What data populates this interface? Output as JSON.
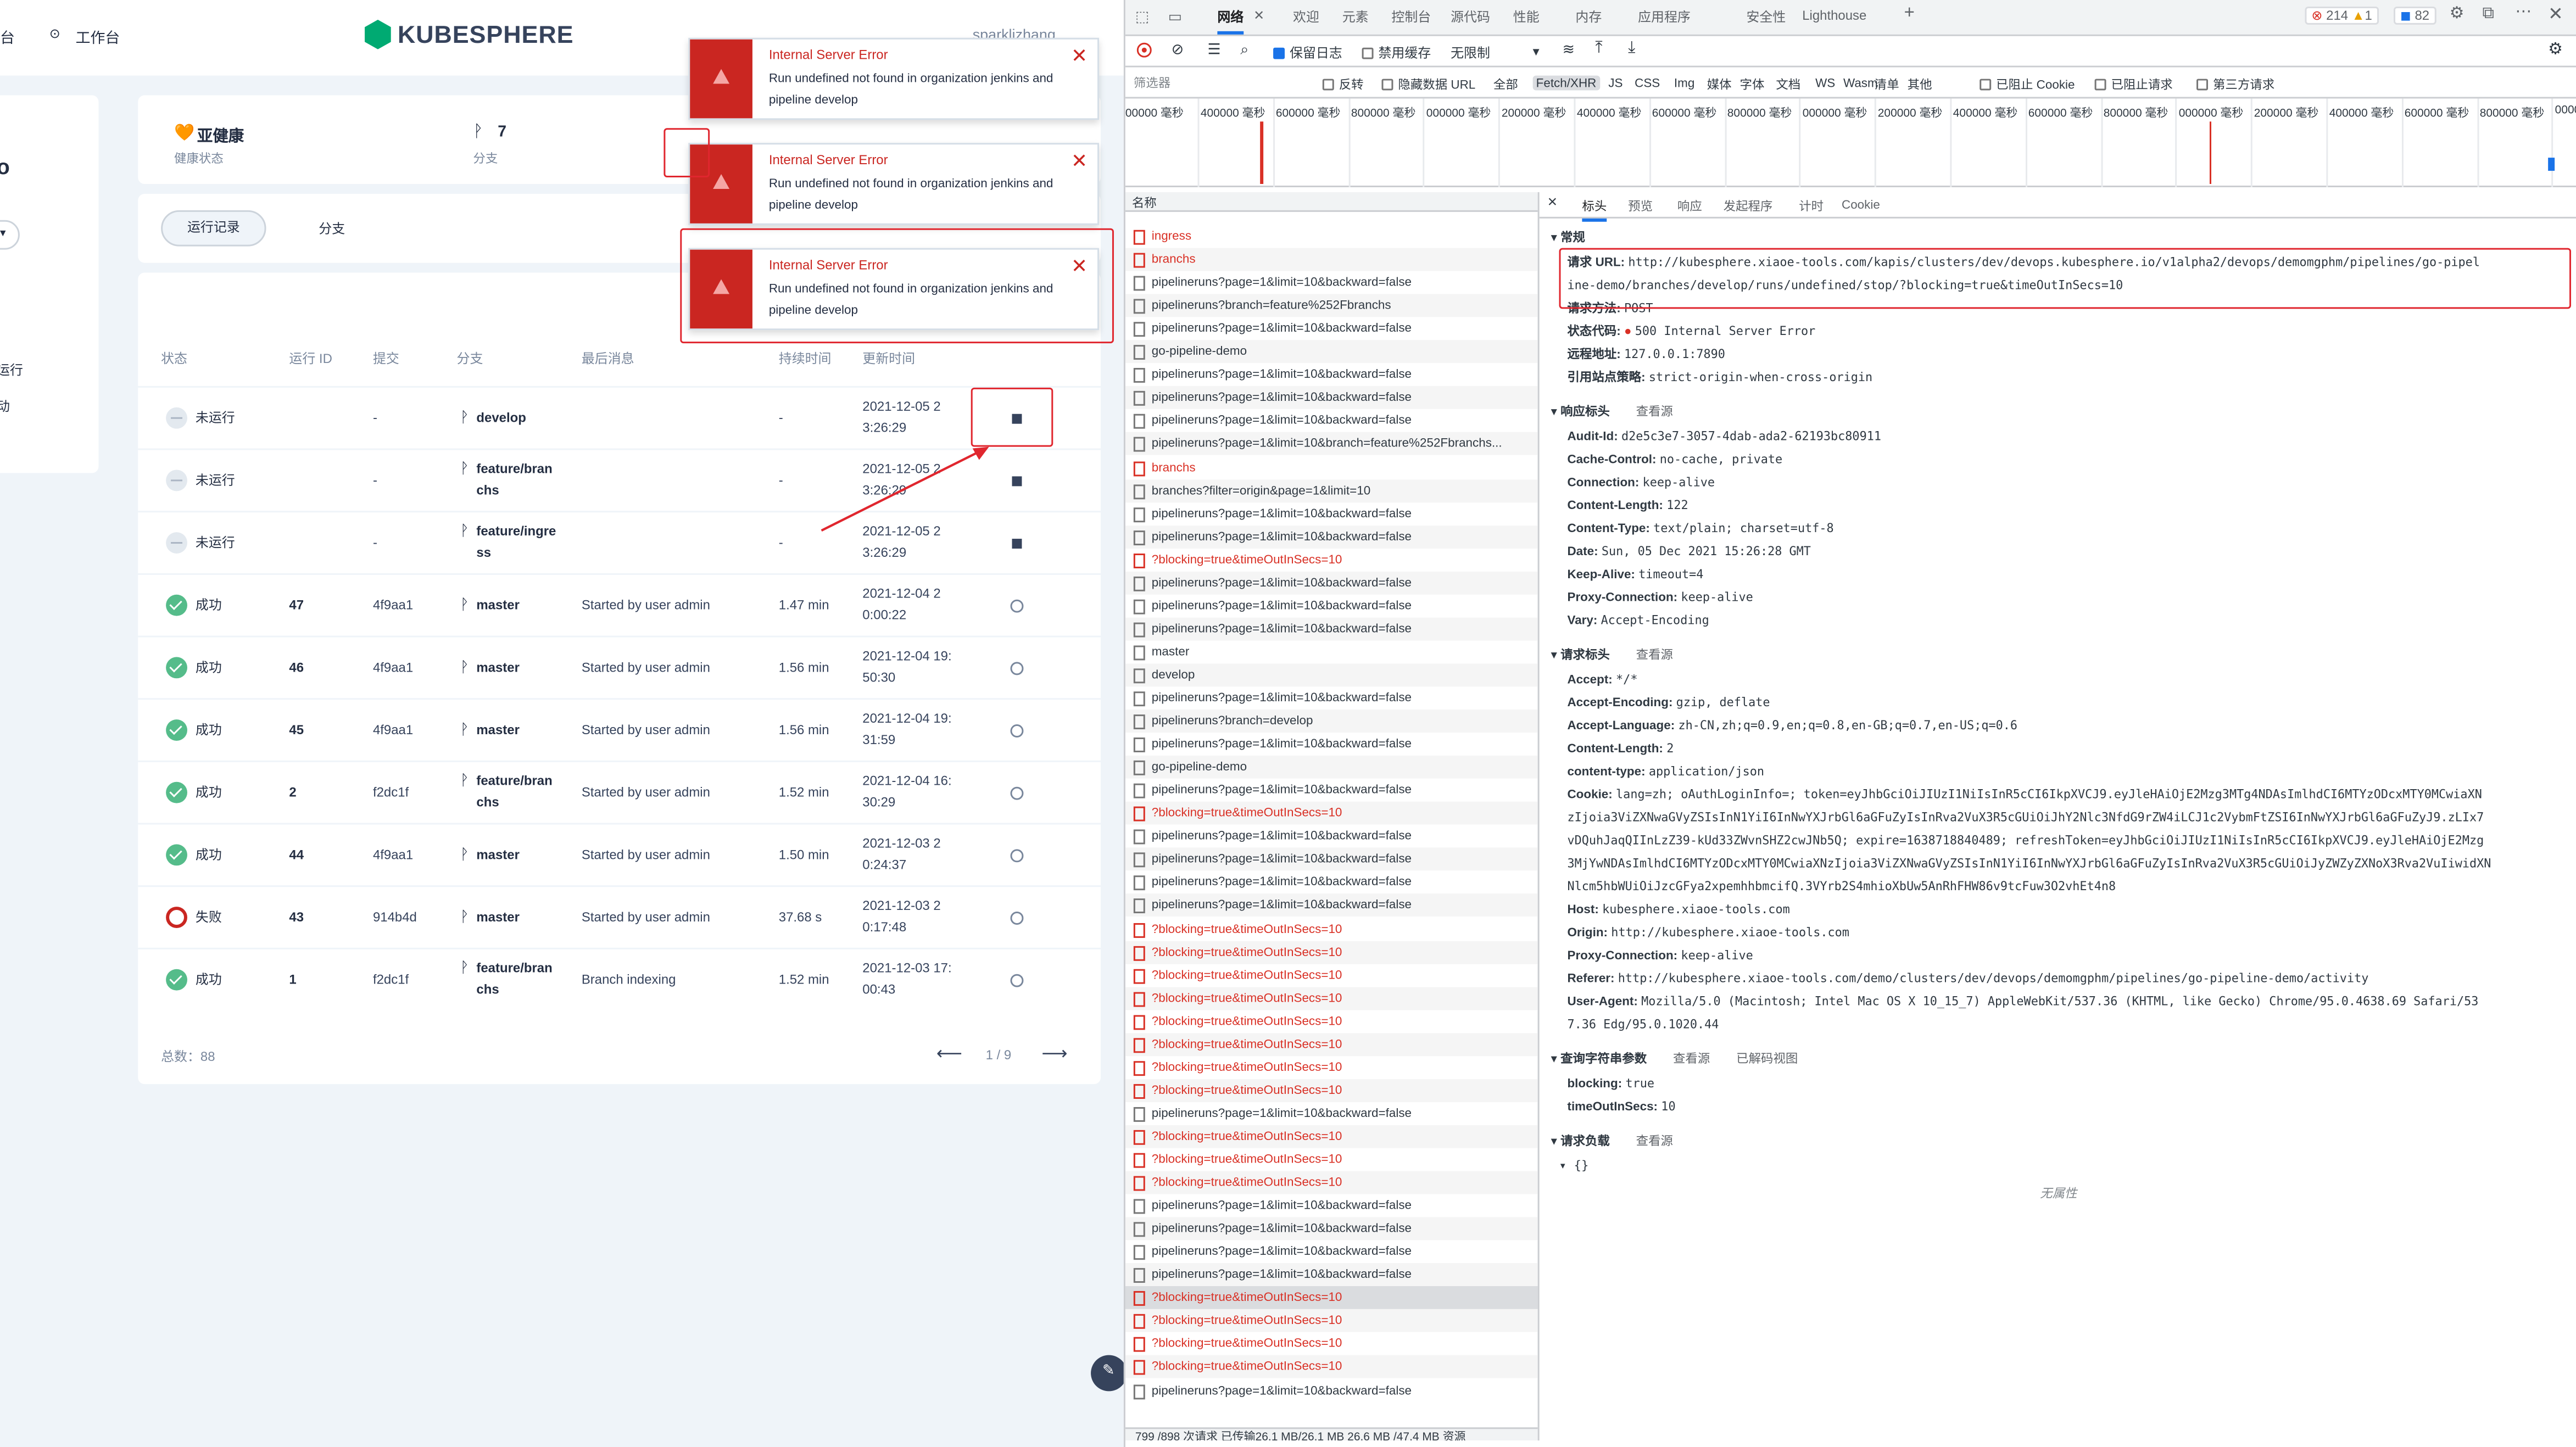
{
  "app": {
    "nav": {
      "left_partial": "台",
      "workbench": "工作台",
      "logo": "KUBESPHERE",
      "user": "sparklizhang"
    },
    "side": {
      "title_partial": "o",
      "item1": "运行",
      "item2": "动"
    },
    "info": {
      "health_value": "亚健康",
      "health_label": "健康状态",
      "branch_count": "7",
      "branch_label": "分支"
    },
    "tabs": {
      "active": "运行记录",
      "other": "分支"
    },
    "table": {
      "headers": [
        "状态",
        "运行 ID",
        "提交",
        "分支",
        "最后消息",
        "持续时间",
        "更新时间"
      ],
      "rows": [
        {
          "status": "未运行",
          "kind": "none",
          "id": "",
          "commit": "-",
          "branch": "develop",
          "msg": "",
          "duration": "-",
          "time": "2021-12-05 2\n3:26:29",
          "action": "stop"
        },
        {
          "status": "未运行",
          "kind": "none",
          "id": "",
          "commit": "-",
          "branch": "feature/bran\nchs",
          "msg": "",
          "duration": "-",
          "time": "2021-12-05 2\n3:26:29",
          "action": "stop"
        },
        {
          "status": "未运行",
          "kind": "none",
          "id": "",
          "commit": "-",
          "branch": "feature/ingre\nss",
          "msg": "",
          "duration": "-",
          "time": "2021-12-05 2\n3:26:29",
          "action": "stop"
        },
        {
          "status": "成功",
          "kind": "ok",
          "id": "47",
          "commit": "4f9aa1",
          "branch": "master",
          "msg": "Started by user admin",
          "duration": "1.47 min",
          "time": "2021-12-04 2\n0:00:22",
          "action": "rerun"
        },
        {
          "status": "成功",
          "kind": "ok",
          "id": "46",
          "commit": "4f9aa1",
          "branch": "master",
          "msg": "Started by user admin",
          "duration": "1.56 min",
          "time": "2021-12-04 19:\n50:30",
          "action": "rerun"
        },
        {
          "status": "成功",
          "kind": "ok",
          "id": "45",
          "commit": "4f9aa1",
          "branch": "master",
          "msg": "Started by user admin",
          "duration": "1.56 min",
          "time": "2021-12-04 19:\n31:59",
          "action": "rerun"
        },
        {
          "status": "成功",
          "kind": "ok",
          "id": "2",
          "commit": "f2dc1f",
          "branch": "feature/bran\nchs",
          "msg": "Started by user admin",
          "duration": "1.52 min",
          "time": "2021-12-04 16:\n30:29",
          "action": "rerun"
        },
        {
          "status": "成功",
          "kind": "ok",
          "id": "44",
          "commit": "4f9aa1",
          "branch": "master",
          "msg": "Started by user admin",
          "duration": "1.50 min",
          "time": "2021-12-03 2\n0:24:37",
          "action": "rerun"
        },
        {
          "status": "失败",
          "kind": "fail",
          "id": "43",
          "commit": "914b4d",
          "branch": "master",
          "msg": "Started by user admin",
          "duration": "37.68 s",
          "time": "2021-12-03 2\n0:17:48",
          "action": "rerun"
        },
        {
          "status": "成功",
          "kind": "ok",
          "id": "1",
          "commit": "f2dc1f",
          "branch": "feature/bran\nchs",
          "msg": "Branch indexing",
          "duration": "1.52 min",
          "time": "2021-12-03 17:\n00:43",
          "action": "rerun"
        }
      ],
      "total": "总数：88",
      "page": "1 / 9"
    },
    "toasts": [
      {
        "title": "Internal Server Error",
        "msg": "Run undefined not found in organization jenkins and pipeline develop"
      },
      {
        "title": "Internal Server Error",
        "msg": "Run undefined not found in organization jenkins and pipeline develop"
      },
      {
        "title": "Internal Server Error",
        "msg": "Run undefined not found in organization jenkins and pipeline develop"
      }
    ]
  },
  "devtools": {
    "tabs": [
      "网络",
      "欢迎",
      "元素",
      "控制台",
      "源代码",
      "性能",
      "内存",
      "应用程序",
      "安全性",
      "Lighthouse"
    ],
    "counts": {
      "errors": "214",
      "warnings": "1",
      "info": "82"
    },
    "toolbar": {
      "preserve_log": "保留日志",
      "disable_cache": "禁用缓存",
      "throttle": "无限制"
    },
    "filter": {
      "placeholder": "筛选器",
      "invert": "反转",
      "hide_data": "隐藏数据 URL",
      "all": "全部",
      "types": [
        "Fetch/XHR",
        "JS",
        "CSS",
        "Img",
        "媒体",
        "字体",
        "文档",
        "WS",
        "Wasm",
        "清单",
        "其他"
      ],
      "blocked_cookies": "已阻止 Cookie",
      "blocked_requests": "已阻止请求",
      "third_party": "第三方请求"
    },
    "timeline_ticks": [
      "00000 毫秒",
      "400000 毫秒",
      "600000 毫秒",
      "800000 毫秒",
      "000000 毫秒",
      "200000 毫秒",
      "400000 毫秒",
      "600000 毫秒",
      "800000 毫秒",
      "000000 毫秒",
      "200000 毫秒",
      "400000 毫秒",
      "600000 毫秒",
      "800000 毫秒",
      "000000 毫秒",
      "200000 毫秒",
      "400000 毫秒",
      "600000 毫秒",
      "800000 毫秒",
      "000000"
    ],
    "name_header": "名称",
    "requests": [
      {
        "n": "ingress",
        "e": true
      },
      {
        "n": "branchs",
        "e": true
      },
      {
        "n": "pipelineruns?page=1&limit=10&backward=false",
        "e": false
      },
      {
        "n": "pipelineruns?branch=feature%252Fbranchs",
        "e": false
      },
      {
        "n": "pipelineruns?page=1&limit=10&backward=false",
        "e": false
      },
      {
        "n": "go-pipeline-demo",
        "e": false
      },
      {
        "n": "pipelineruns?page=1&limit=10&backward=false",
        "e": false
      },
      {
        "n": "pipelineruns?page=1&limit=10&backward=false",
        "e": false
      },
      {
        "n": "pipelineruns?page=1&limit=10&backward=false",
        "e": false
      },
      {
        "n": "pipelineruns?page=1&limit=10&branch=feature%252Fbranchs...",
        "e": false
      },
      {
        "n": "branchs",
        "e": true
      },
      {
        "n": "branches?filter=origin&page=1&limit=10",
        "e": false
      },
      {
        "n": "pipelineruns?page=1&limit=10&backward=false",
        "e": false
      },
      {
        "n": "pipelineruns?page=1&limit=10&backward=false",
        "e": false
      },
      {
        "n": "?blocking=true&timeOutInSecs=10",
        "e": true
      },
      {
        "n": "pipelineruns?page=1&limit=10&backward=false",
        "e": false
      },
      {
        "n": "pipelineruns?page=1&limit=10&backward=false",
        "e": false
      },
      {
        "n": "pipelineruns?page=1&limit=10&backward=false",
        "e": false
      },
      {
        "n": "master",
        "e": false
      },
      {
        "n": "develop",
        "e": false
      },
      {
        "n": "pipelineruns?page=1&limit=10&backward=false",
        "e": false
      },
      {
        "n": "pipelineruns?branch=develop",
        "e": false
      },
      {
        "n": "pipelineruns?page=1&limit=10&backward=false",
        "e": false
      },
      {
        "n": "go-pipeline-demo",
        "e": false
      },
      {
        "n": "pipelineruns?page=1&limit=10&backward=false",
        "e": false
      },
      {
        "n": "?blocking=true&timeOutInSecs=10",
        "e": true
      },
      {
        "n": "pipelineruns?page=1&limit=10&backward=false",
        "e": false
      },
      {
        "n": "pipelineruns?page=1&limit=10&backward=false",
        "e": false
      },
      {
        "n": "pipelineruns?page=1&limit=10&backward=false",
        "e": false
      },
      {
        "n": "pipelineruns?page=1&limit=10&backward=false",
        "e": false
      },
      {
        "n": "?blocking=true&timeOutInSecs=10",
        "e": true
      },
      {
        "n": "?blocking=true&timeOutInSecs=10",
        "e": true
      },
      {
        "n": "?blocking=true&timeOutInSecs=10",
        "e": true
      },
      {
        "n": "?blocking=true&timeOutInSecs=10",
        "e": true
      },
      {
        "n": "?blocking=true&timeOutInSecs=10",
        "e": true
      },
      {
        "n": "?blocking=true&timeOutInSecs=10",
        "e": true
      },
      {
        "n": "?blocking=true&timeOutInSecs=10",
        "e": true
      },
      {
        "n": "?blocking=true&timeOutInSecs=10",
        "e": true
      },
      {
        "n": "pipelineruns?page=1&limit=10&backward=false",
        "e": false
      },
      {
        "n": "?blocking=true&timeOutInSecs=10",
        "e": true
      },
      {
        "n": "?blocking=true&timeOutInSecs=10",
        "e": true
      },
      {
        "n": "?blocking=true&timeOutInSecs=10",
        "e": true
      },
      {
        "n": "pipelineruns?page=1&limit=10&backward=false",
        "e": false
      },
      {
        "n": "pipelineruns?page=1&limit=10&backward=false",
        "e": false
      },
      {
        "n": "pipelineruns?page=1&limit=10&backward=false",
        "e": false
      },
      {
        "n": "pipelineruns?page=1&limit=10&backward=false",
        "e": false
      },
      {
        "n": "?blocking=true&timeOutInSecs=10",
        "e": true,
        "sel": true
      },
      {
        "n": "?blocking=true&timeOutInSecs=10",
        "e": true
      },
      {
        "n": "?blocking=true&timeOutInSecs=10",
        "e": true
      },
      {
        "n": "?blocking=true&timeOutInSecs=10",
        "e": true
      },
      {
        "n": "pipelineruns?page=1&limit=10&backward=false",
        "e": false
      }
    ],
    "status_bar": "799 /898 次请求  已传输26.1 MB/26.1 MB  26.6 MB /47.4 MB 资源",
    "detail_tabs": [
      "标头",
      "预览",
      "响应",
      "发起程序",
      "计时",
      "Cookie"
    ],
    "general": {
      "title": "常规",
      "rows": [
        {
          "k": "请求 URL:",
          "v": "http://kubesphere.xiaoe-tools.com/kapis/clusters/dev/devops.kubesphere.io/v1alpha2/devops/demomgphm/pipelines/go-pipel"
        },
        {
          "k": "",
          "v": "ine-demo/branches/develop/runs/undefined/stop/?blocking=true&timeOutInSecs=10"
        },
        {
          "k": "请求方法:",
          "v": "POST"
        },
        {
          "k": "状态代码:",
          "v": "500 Internal Server Error"
        },
        {
          "k": "远程地址:",
          "v": "127.0.0.1:7890"
        },
        {
          "k": "引用站点策略:",
          "v": "strict-origin-when-cross-origin"
        }
      ]
    },
    "response_headers": {
      "title": "响应标头",
      "source": "查看源",
      "rows": [
        {
          "k": "Audit-Id:",
          "v": "d2e5c3e7-3057-4dab-ada2-62193bc80911"
        },
        {
          "k": "Cache-Control:",
          "v": "no-cache, private"
        },
        {
          "k": "Connection:",
          "v": "keep-alive"
        },
        {
          "k": "Content-Length:",
          "v": "122"
        },
        {
          "k": "Content-Type:",
          "v": "text/plain; charset=utf-8"
        },
        {
          "k": "Date:",
          "v": "Sun, 05 Dec 2021 15:26:28 GMT"
        },
        {
          "k": "Keep-Alive:",
          "v": "timeout=4"
        },
        {
          "k": "Proxy-Connection:",
          "v": "keep-alive"
        },
        {
          "k": "Vary:",
          "v": "Accept-Encoding"
        }
      ]
    },
    "request_headers": {
      "title": "请求标头",
      "source": "查看源",
      "rows": [
        {
          "k": "Accept:",
          "v": "*/*"
        },
        {
          "k": "Accept-Encoding:",
          "v": "gzip, deflate"
        },
        {
          "k": "Accept-Language:",
          "v": "zh-CN,zh;q=0.9,en;q=0.8,en-GB;q=0.7,en-US;q=0.6"
        },
        {
          "k": "Content-Length:",
          "v": "2"
        },
        {
          "k": "content-type:",
          "v": "application/json"
        },
        {
          "k": "Cookie:",
          "v": "lang=zh; oAuthLoginInfo=; token=eyJhbGciOiJIUzI1NiIsInR5cCI6IkpXVCJ9.eyJleHAiOjE2Mzg3MTg4NDAsImlhdCI6MTYzODcxMTY0MCwiaXN"
        },
        {
          "k": "",
          "v": "zIjoia3ViZXNwaGVyZSIsInN1YiI6InNwYXJrbGl6aGFuZyIsInRva2VuX3R5cGUiOiJhY2Nlc3NfdG9rZW4iLCJ1c2VybmFtZSI6InNwYXJrbGl6aGFuZyJ9.zLIx7"
        },
        {
          "k": "",
          "v": "vDQuhJaqQIInLzZ39-kUd33ZWvnSHZ2cwJNb5Q; expire=1638718840489; refreshToken=eyJhbGciOiJIUzI1NiIsInR5cCI6IkpXVCJ9.eyJleHAiOjE2Mzg"
        },
        {
          "k": "",
          "v": "3MjYwNDAsImlhdCI6MTYzODcxMTY0MCwiaXNzIjoia3ViZXNwaGVyZSIsInN1YiI6InNwYXJrbGl6aGFuZyIsInRva2VuX3R5cGUiOiJyZWZyZXNoX3Rva2VuIiwidXN"
        },
        {
          "k": "",
          "v": "Nlcm5hbWUiOiJzcGFya2xpemhhbmcifQ.3VYrb2S4mhioXbUw5AnRhFHW86v9tcFuw3O2vhEt4n8"
        },
        {
          "k": "Host:",
          "v": "kubesphere.xiaoe-tools.com"
        },
        {
          "k": "Origin:",
          "v": "http://kubesphere.xiaoe-tools.com"
        },
        {
          "k": "Proxy-Connection:",
          "v": "keep-alive"
        },
        {
          "k": "Referer:",
          "v": "http://kubesphere.xiaoe-tools.com/demo/clusters/dev/devops/demomgphm/pipelines/go-pipeline-demo/activity"
        },
        {
          "k": "User-Agent:",
          "v": "Mozilla/5.0 (Macintosh; Intel Mac OS X 10_15_7) AppleWebKit/537.36 (KHTML, like Gecko) Chrome/95.0.4638.69 Safari/53"
        },
        {
          "k": "",
          "v": "7.36 Edg/95.0.1020.44"
        }
      ]
    },
    "query": {
      "title": "查询字符串参数",
      "source": "查看源",
      "decoded": "已解码视图",
      "rows": [
        {
          "k": "blocking:",
          "v": "true"
        },
        {
          "k": "timeOutInSecs:",
          "v": "10"
        }
      ]
    },
    "payload": {
      "title": "请求负载",
      "source": "查看源",
      "body": "{}",
      "empty": "无属性"
    }
  }
}
